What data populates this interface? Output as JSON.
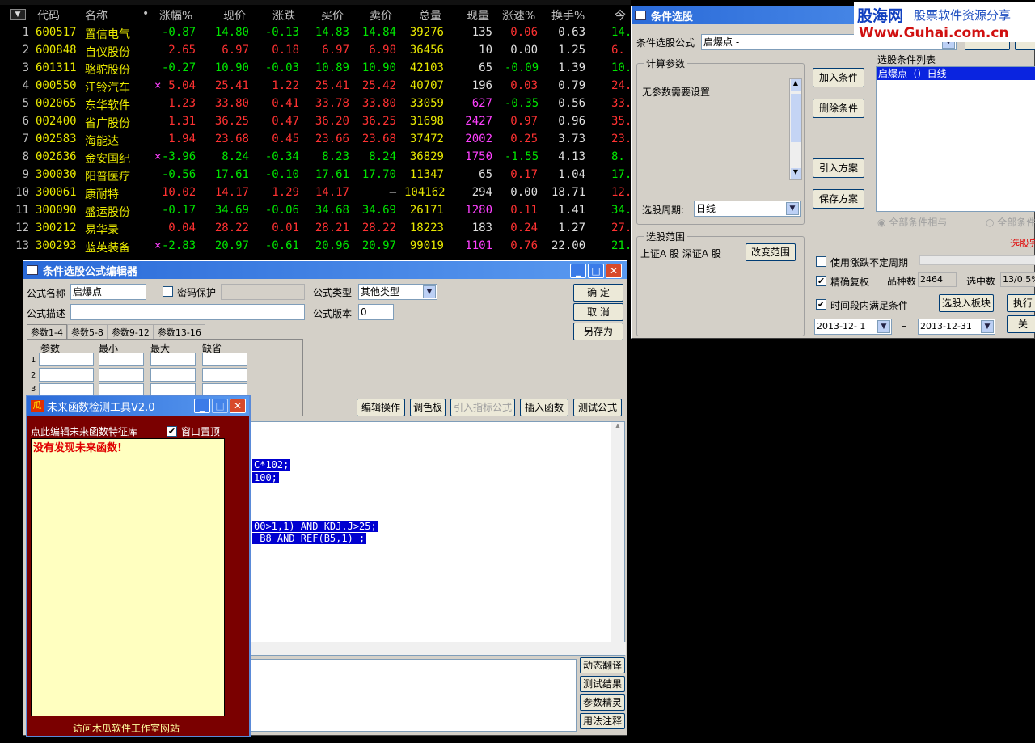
{
  "quote_table": {
    "header": {
      "code": "代码",
      "name": "名称",
      "dot": "•",
      "pct": "涨幅%",
      "price": "现价",
      "change": "涨跌",
      "bid": "买价",
      "ask": "卖价",
      "volume": "总量",
      "cur_vol": "现量",
      "speed": "涨速%",
      "turnover": "换手%",
      "extra": "今"
    },
    "rows": [
      {
        "n": "1",
        "code": "600517",
        "name": "置信电气",
        "x": "",
        "pct": "-0.87",
        "price": "14.80",
        "chg": "-0.13",
        "bid": "14.83",
        "ask": "14.84",
        "vol": "39276",
        "cv": "135",
        "spd": "0.06",
        "to": "0.63",
        "ex": "14."
      },
      {
        "n": "2",
        "code": "600848",
        "name": "自仪股份",
        "x": "",
        "pct": "2.65",
        "price": "6.97",
        "chg": "0.18",
        "bid": "6.97",
        "ask": "6.98",
        "vol": "36456",
        "cv": "10",
        "spd": "0.00",
        "to": "1.25",
        "ex": "6."
      },
      {
        "n": "3",
        "code": "601311",
        "name": "骆驼股份",
        "x": "",
        "pct": "-0.27",
        "price": "10.90",
        "chg": "-0.03",
        "bid": "10.89",
        "ask": "10.90",
        "vol": "42103",
        "cv": "65",
        "spd": "-0.09",
        "to": "1.39",
        "ex": "10."
      },
      {
        "n": "4",
        "code": "000550",
        "name": "江铃汽车",
        "x": "×",
        "pct": "5.04",
        "price": "25.41",
        "chg": "1.22",
        "bid": "25.41",
        "ask": "25.42",
        "vol": "40707",
        "cv": "196",
        "spd": "0.03",
        "to": "0.79",
        "ex": "24."
      },
      {
        "n": "5",
        "code": "002065",
        "name": "东华软件",
        "x": "",
        "pct": "1.23",
        "price": "33.80",
        "chg": "0.41",
        "bid": "33.78",
        "ask": "33.80",
        "vol": "33059",
        "cv": "627",
        "spd": "-0.35",
        "to": "0.56",
        "ex": "33."
      },
      {
        "n": "6",
        "code": "002400",
        "name": "省广股份",
        "x": "",
        "pct": "1.31",
        "price": "36.25",
        "chg": "0.47",
        "bid": "36.20",
        "ask": "36.25",
        "vol": "31698",
        "cv": "2427",
        "spd": "0.97",
        "to": "0.96",
        "ex": "35."
      },
      {
        "n": "7",
        "code": "002583",
        "name": "海能达",
        "x": "",
        "pct": "1.94",
        "price": "23.68",
        "chg": "0.45",
        "bid": "23.66",
        "ask": "23.68",
        "vol": "37472",
        "cv": "2002",
        "spd": "0.25",
        "to": "3.73",
        "ex": "23."
      },
      {
        "n": "8",
        "code": "002636",
        "name": "金安国纪",
        "x": "×",
        "pct": "-3.96",
        "price": "8.24",
        "chg": "-0.34",
        "bid": "8.23",
        "ask": "8.24",
        "vol": "36829",
        "cv": "1750",
        "spd": "-1.55",
        "to": "4.13",
        "ex": "8."
      },
      {
        "n": "9",
        "code": "300030",
        "name": "阳普医疗",
        "x": "",
        "pct": "-0.56",
        "price": "17.61",
        "chg": "-0.10",
        "bid": "17.61",
        "ask": "17.70",
        "vol": "11347",
        "cv": "65",
        "spd": "0.17",
        "to": "1.04",
        "ex": "17."
      },
      {
        "n": "10",
        "code": "300061",
        "name": "康耐特",
        "x": "",
        "pct": "10.02",
        "price": "14.17",
        "chg": "1.29",
        "bid": "14.17",
        "ask": "—",
        "vol": "104162",
        "cv": "294",
        "spd": "0.00",
        "to": "18.71",
        "ex": "12."
      },
      {
        "n": "11",
        "code": "300090",
        "name": "盛运股份",
        "x": "",
        "pct": "-0.17",
        "price": "34.69",
        "chg": "-0.06",
        "bid": "34.68",
        "ask": "34.69",
        "vol": "26171",
        "cv": "1280",
        "spd": "0.11",
        "to": "1.41",
        "ex": "34."
      },
      {
        "n": "12",
        "code": "300212",
        "name": "易华录",
        "x": "",
        "pct": "0.04",
        "price": "28.22",
        "chg": "0.01",
        "bid": "28.21",
        "ask": "28.22",
        "vol": "18223",
        "cv": "183",
        "spd": "0.24",
        "to": "1.27",
        "ex": "27."
      },
      {
        "n": "13",
        "code": "300293",
        "name": "蓝英装备",
        "x": "×",
        "pct": "-2.83",
        "price": "20.97",
        "chg": "-0.61",
        "bid": "20.96",
        "ask": "20.97",
        "vol": "99019",
        "cv": "1101",
        "spd": "0.76",
        "to": "22.00",
        "ex": "21."
      }
    ]
  },
  "stock_picker": {
    "title": "条件选股",
    "formula_label": "条件选股公式",
    "formula_value": "启爆点   -",
    "params_group": "计算参数",
    "params_text": "无参数需要设置",
    "period_label": "选股周期:",
    "period_value": "日线",
    "range_group": "选股范围",
    "range_text": "上证A 股  深证A 股",
    "change_range": "改变范围",
    "add_cond": "加入条件",
    "del_cond": "删除条件",
    "import_plan": "引入方案",
    "save_plan": "保存方案",
    "list_label": "选股条件列表",
    "list_item": "启爆点  ()  日线",
    "radio_and": "全部条件相与",
    "radio_or": "全部条件",
    "done_text": "选股完",
    "use_period": "使用涨跌不定周期",
    "exact_adj": "精确复权",
    "count_label": "品种数",
    "count_value": "2464",
    "selected_label": "选中数",
    "selected_value": "13/0.5%",
    "time_cond": "时间段内满足条件",
    "to_block": "选股入板块",
    "execute": "执行",
    "close": "关",
    "date_from": "2013-12- 1",
    "date_sep": "–",
    "date_to": "2013-12-31"
  },
  "watermark": {
    "brand": "股海网",
    "slogan": "股票软件资源分享",
    "url": "Www.Guhai.com.cn",
    "accent": "#d01010"
  },
  "editor": {
    "title": "条件选股公式编辑器",
    "name_label": "公式名称",
    "name_value": "启爆点",
    "pwd_label": "密码保护",
    "type_label": "公式类型",
    "type_value": "其他类型",
    "ok": "确  定",
    "cancel": "取  消",
    "save_as": "另存为",
    "desc_label": "公式描述",
    "ver_label": "公式版本",
    "ver_value": "0",
    "tabs": [
      "参数1-4",
      "参数5-8",
      "参数9-12",
      "参数13-16"
    ],
    "col_param": "参数",
    "col_min": "最小",
    "col_max": "最大",
    "col_def": "缺省",
    "r1": "1",
    "r2": "2",
    "r3": "3",
    "btn_edit": "编辑操作",
    "btn_color": "调色板",
    "btn_import": "引入指标公式",
    "btn_insert": "插入函数",
    "btn_test": "测试公式",
    "code1": "C*102;",
    "code2": "100;",
    "code3": "00>1,1) AND KDJ.J>25;",
    "code4": " B8 AND REF(B5,1) ;",
    "side_dyn": "动态翻译",
    "side_res": "测试结果",
    "side_wiz": "参数精灵",
    "side_note": "用法注释"
  },
  "future_tool": {
    "title": "未来函数检测工具V2.0",
    "logo": "瓜",
    "edit_link": "点此编辑未来函数特征库",
    "ontop": "窗口置顶",
    "result": "没有发现未来函数!",
    "footer": "访问木瓜软件工作室网站"
  }
}
